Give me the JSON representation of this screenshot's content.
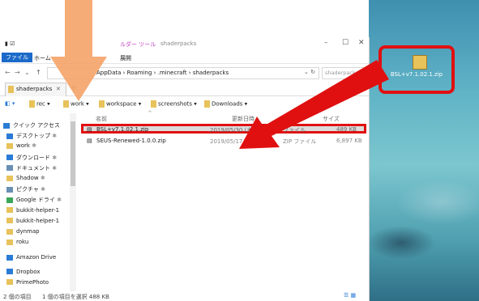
{
  "title": {
    "ribbon_tab_tools": "ルダー ツール",
    "ribbon_tab_name": "shaderpacks"
  },
  "ribbon": {
    "file": "ファイル",
    "home": "ホーム",
    "manage": "展開"
  },
  "window_controls": {
    "min": "–",
    "max": "☐",
    "close": "✕"
  },
  "address": {
    "segments": [
      "AppData",
      "Roaming",
      ".minecraft",
      "shaderpacks"
    ],
    "separator": "›",
    "search_placeholder": "shaderpacks"
  },
  "tab": {
    "label": "shaderpacks",
    "close": "✕",
    "add": "+"
  },
  "bookmarks": [
    "rec",
    "work",
    "workspace",
    "screenshots",
    "Downloads"
  ],
  "nav": {
    "items": [
      {
        "label": "クイック アクセス",
        "icon": "star-icon",
        "color": "#2a7bd6"
      },
      {
        "label": "デスクトップ",
        "icon": "desktop-icon",
        "color": "#2a7bd6"
      },
      {
        "label": "work",
        "icon": "folder-icon",
        "color": "#e8c25a"
      },
      {
        "label": "ダウンロード",
        "icon": "download-icon",
        "color": "#2a7bd6"
      },
      {
        "label": "ドキュメント",
        "icon": "document-icon",
        "color": "#6a8fb5"
      },
      {
        "label": "Shadow",
        "icon": "folder-icon",
        "color": "#e8c25a"
      },
      {
        "label": "ピクチャ",
        "icon": "pictures-icon",
        "color": "#6a8fb5"
      },
      {
        "label": "Google ドライ",
        "icon": "google-drive-icon",
        "color": "#3aa757"
      },
      {
        "label": "bukkit-helper-1",
        "icon": "folder-icon",
        "color": "#e8c25a"
      },
      {
        "label": "bukkit-helper-1",
        "icon": "folder-icon",
        "color": "#e8c25a"
      },
      {
        "label": "dynmap",
        "icon": "folder-icon",
        "color": "#e8c25a"
      },
      {
        "label": "roku",
        "icon": "folder-icon",
        "color": "#e8c25a"
      },
      {
        "label": "Amazon Drive",
        "icon": "amazon-drive-icon",
        "color": "#2a7bd6"
      },
      {
        "label": "Dropbox",
        "icon": "dropbox-icon",
        "color": "#2a7bd6"
      },
      {
        "label": "PrimePhoto",
        "icon": "folder-icon",
        "color": "#e8c25a"
      }
    ]
  },
  "columns": {
    "name": "名前",
    "date": "更新日時",
    "type": "",
    "size": "サイズ"
  },
  "files": [
    {
      "name": "BSL+v7.1.02.1.zip",
      "date": "2019/05/30 (木) ...",
      "type": "ファイル",
      "size": "489 KB"
    },
    {
      "name": "SEUS-Renewed-1.0.0.zip",
      "date": "2019/05/17 (金) 20...",
      "type": "ZIP ファイル",
      "size": "6,897 KB"
    }
  ],
  "status": {
    "count": "2 個の項目",
    "selected": "1 個の項目を選択  488 KB"
  },
  "desktop": {
    "file_label": "BSL+v7.1.02.1.zip"
  },
  "colors": {
    "highlight": "#e01010",
    "arrow_orange": "#f5a56a",
    "accent": "#1b6ac9"
  }
}
